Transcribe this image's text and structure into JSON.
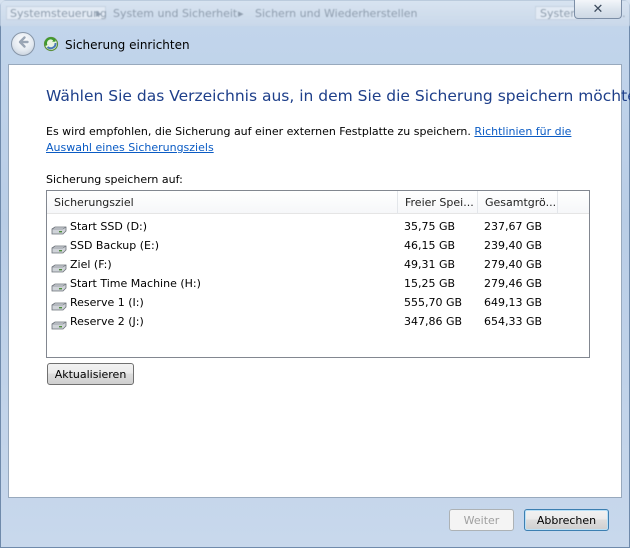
{
  "background_breadcrumb": {
    "segments": [
      "Systemsteuerung",
      "System und Sicherheit",
      "Sichern und Wiederherstellen"
    ],
    "search_placeholder": "Systemsteuer..."
  },
  "window": {
    "title": "Sicherung einrichten",
    "close_label": "✕"
  },
  "main": {
    "heading": "Wählen Sie das Verzeichnis aus, in dem Sie die Sicherung speichern möchten.",
    "description": "Es wird empfohlen, die Sicherung auf einer externen Festplatte zu speichern.",
    "link": "Richtlinien für die Auswahl eines Sicherungsziels",
    "list_label": "Sicherung speichern auf:"
  },
  "table": {
    "columns": [
      "Sicherungsziel",
      "Freier Spei...",
      "Gesamtgrö..."
    ],
    "rows": [
      {
        "name": "Start SSD (D:)",
        "free": "35,75 GB",
        "total": "237,67 GB"
      },
      {
        "name": "SSD Backup (E:)",
        "free": "46,15 GB",
        "total": "239,40 GB"
      },
      {
        "name": "Ziel (F:)",
        "free": "49,31 GB",
        "total": "279,40 GB"
      },
      {
        "name": "Start Time Machine (H:)",
        "free": "15,25 GB",
        "total": "279,46 GB"
      },
      {
        "name": "Reserve 1 (I:)",
        "free": "555,70 GB",
        "total": "649,13 GB"
      },
      {
        "name": "Reserve 2 (J:)",
        "free": "347,86 GB",
        "total": "654,33 GB"
      }
    ]
  },
  "buttons": {
    "refresh": "Aktualisieren",
    "next": "Weiter",
    "cancel": "Abbrechen"
  },
  "colors": {
    "heading": "#1e3f8a",
    "link": "#0a5bc4"
  },
  "icons": {
    "back": "back-arrow-icon",
    "app": "backup-icon",
    "drive": "hard-drive-icon"
  }
}
